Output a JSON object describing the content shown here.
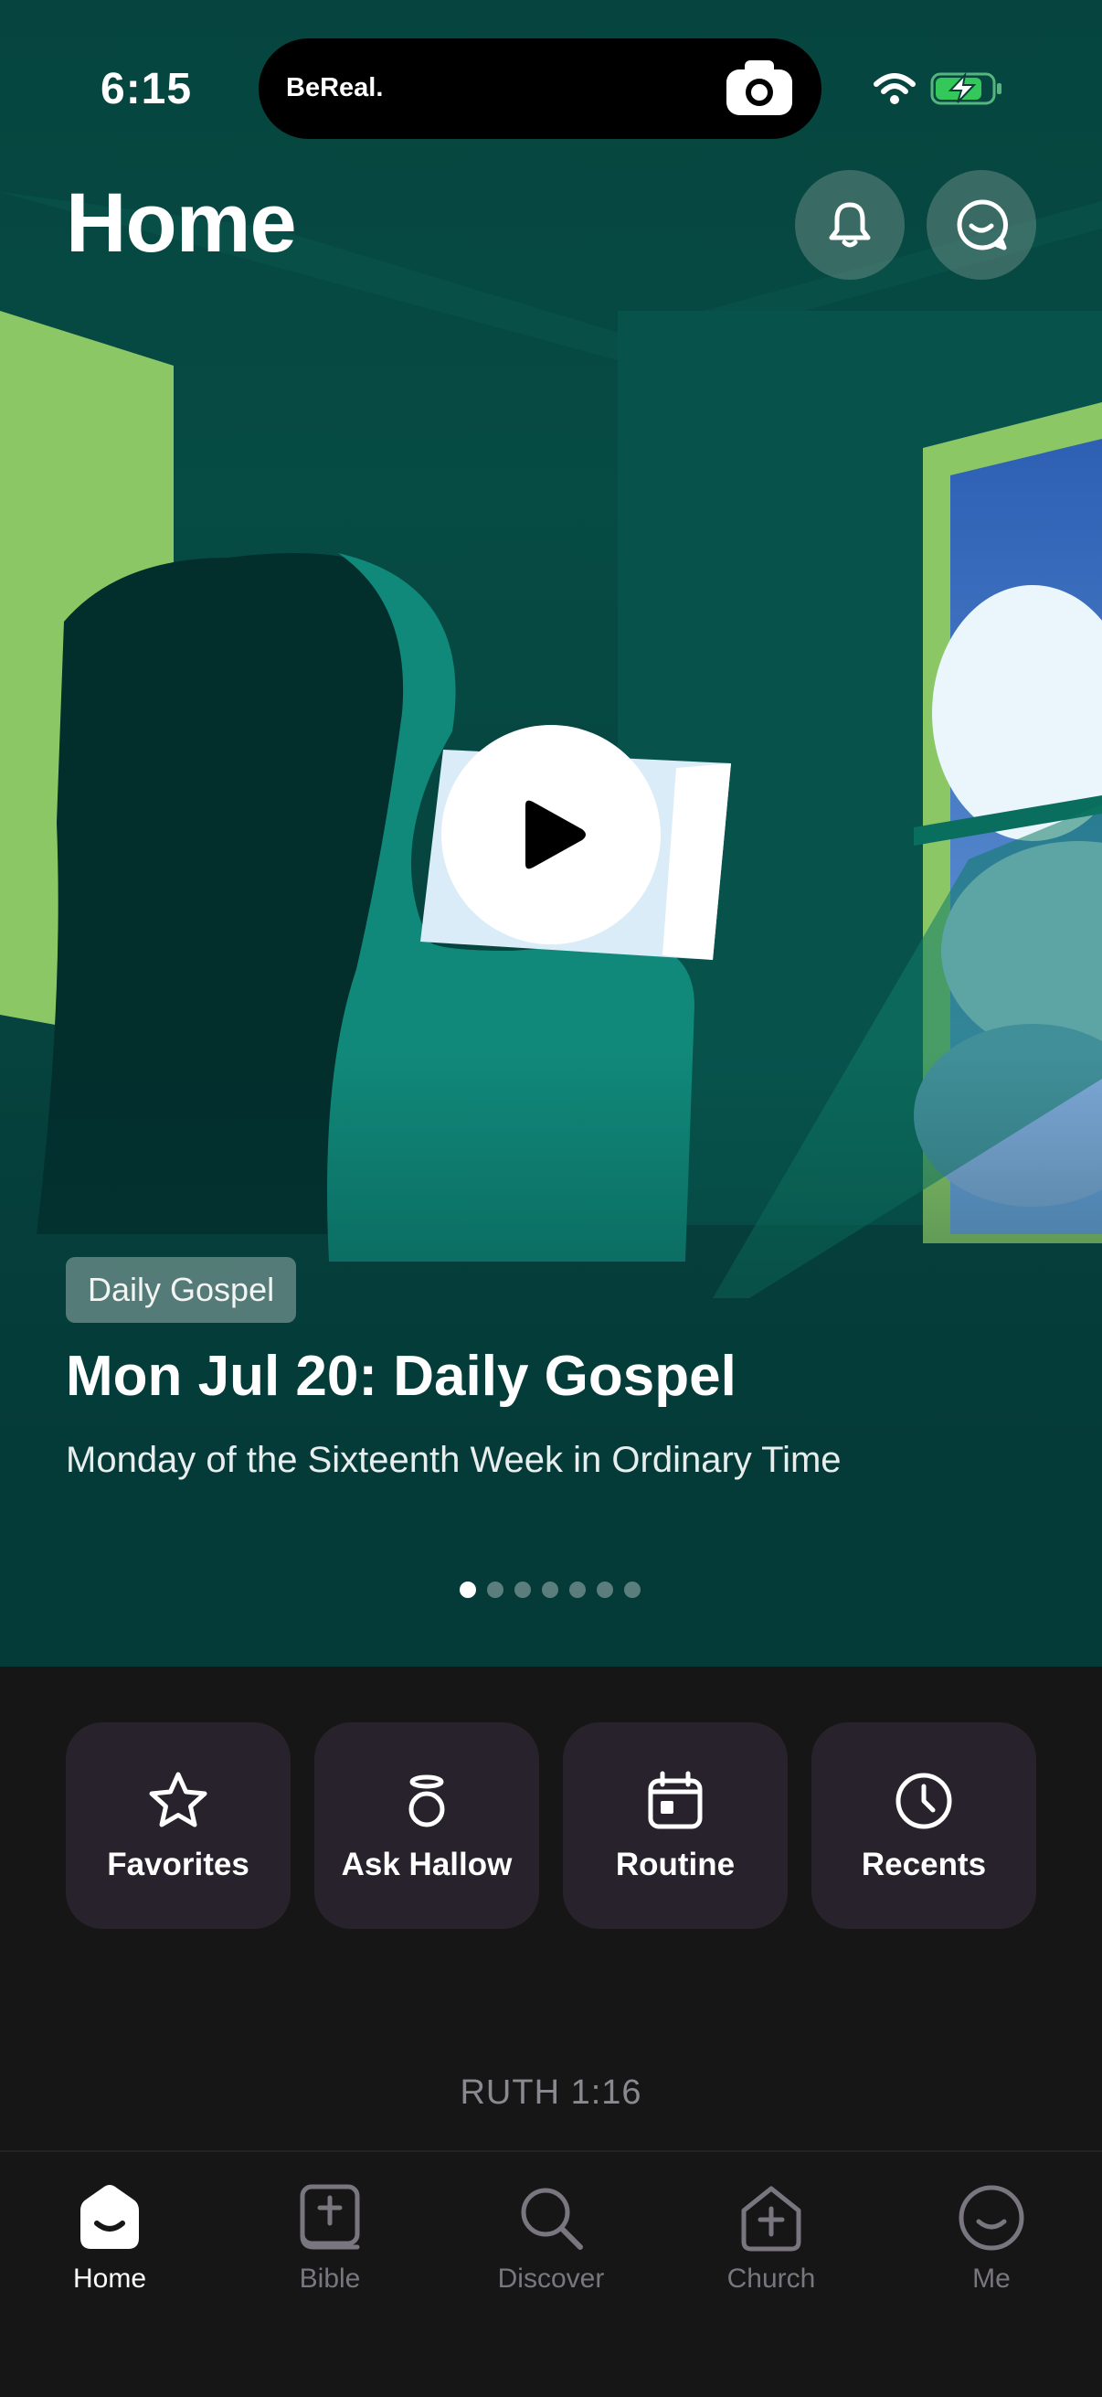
{
  "status_bar": {
    "time": "6:15",
    "island_app": "BeReal.",
    "icons": [
      "camera-icon",
      "wifi-icon",
      "battery-charging-icon"
    ]
  },
  "header": {
    "title": "Home",
    "icons": [
      "bell-icon",
      "chat-icon"
    ]
  },
  "hero": {
    "tag": "Daily Gospel",
    "title": "Mon Jul 20: Daily Gospel",
    "subtitle": "Monday of the Sixteenth Week in Ordinary Time",
    "carousel_pages": 7,
    "carousel_active_index": 0,
    "icon": "play-icon"
  },
  "actions": [
    {
      "label": "Favorites",
      "icon": "star-icon"
    },
    {
      "label": "Ask Hallow",
      "icon": "halo-icon"
    },
    {
      "label": "Routine",
      "icon": "calendar-icon"
    },
    {
      "label": "Recents",
      "icon": "clock-icon"
    }
  ],
  "verse_ref": "RUTH 1:16",
  "tabs": [
    {
      "label": "Home",
      "icon": "home-icon",
      "active": true
    },
    {
      "label": "Bible",
      "icon": "bible-icon",
      "active": false
    },
    {
      "label": "Discover",
      "icon": "search-icon",
      "active": false
    },
    {
      "label": "Church",
      "icon": "church-icon",
      "active": false
    },
    {
      "label": "Me",
      "icon": "me-icon",
      "active": false
    }
  ],
  "colors": {
    "hero_bg": "#064b44",
    "card_bg": "#27222b",
    "page_bg": "#161616",
    "inactive_tab": "#7a7680",
    "battery_green": "#34c759"
  }
}
